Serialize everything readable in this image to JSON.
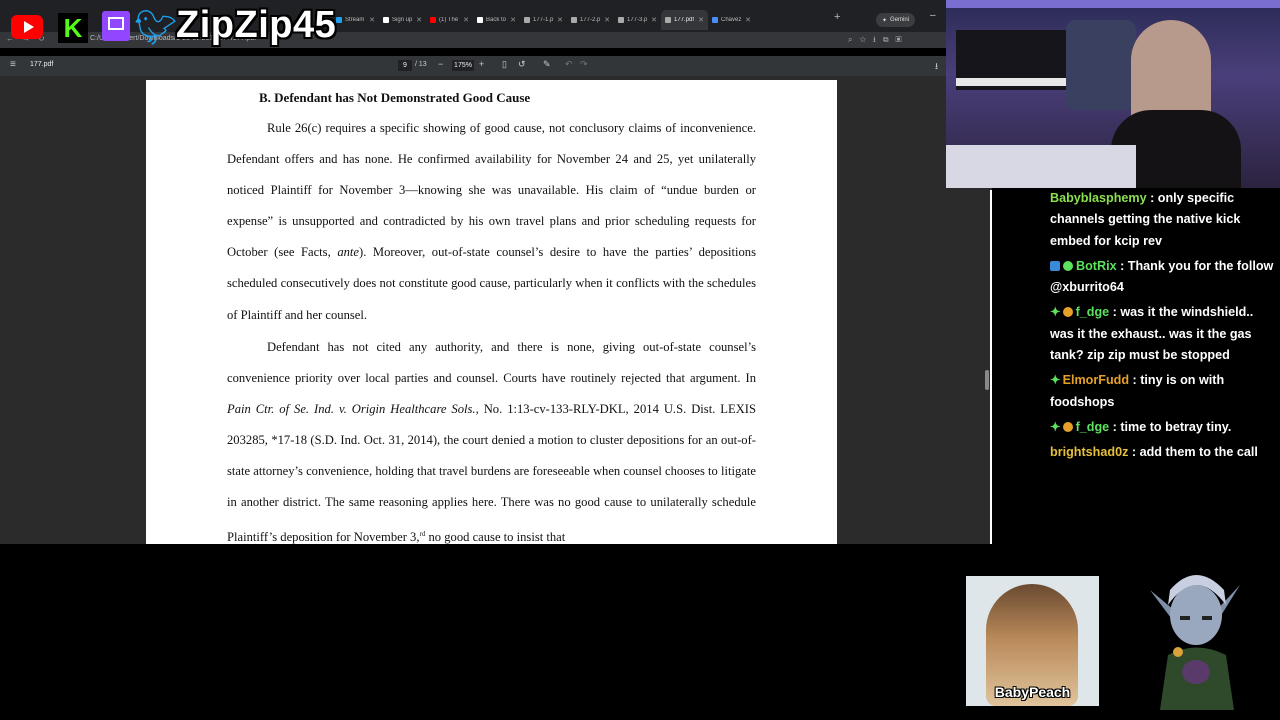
{
  "overlay": {
    "brand_name": "ZipZip45",
    "logos": [
      "youtube-logo",
      "kick-logo",
      "twitch-logo",
      "twitter-logo"
    ]
  },
  "browser": {
    "tabs": [
      {
        "title": "Stream",
        "color": "#1da1f2"
      },
      {
        "title": "Sign up",
        "color": "#ffffff"
      },
      {
        "title": "(1) The",
        "color": "#ff0000"
      },
      {
        "title": "Back to",
        "color": "#ffffff"
      },
      {
        "title": "177-1.p",
        "color": "#aaaaaa"
      },
      {
        "title": "177-2.p",
        "color": "#aaaaaa"
      },
      {
        "title": "177-3.p",
        "color": "#aaaaaa"
      },
      {
        "title": "177.pdf",
        "color": "#aaaaaa",
        "active": true
      },
      {
        "title": "Chavez",
        "color": "#4a8df8"
      }
    ],
    "gemini_label": "Gemini",
    "url": "C:/Users/robert/Downloads/1-25-cv-2019/177/177.pdf"
  },
  "pdf_toolbar": {
    "file_name": "177.pdf",
    "page_current": "9",
    "page_total": "/ 13",
    "zoom": "175%"
  },
  "document": {
    "heading": "B. Defendant has Not Demonstrated Good Cause",
    "para1": "Rule 26(c) requires a specific showing of good cause, not conclusory claims of inconvenience. Defendant offers and has none. He confirmed availability for November 24 and 25, yet unilaterally noticed Plaintiff for November 3—knowing she was unavailable. His claim of “undue burden or expense” is unsupported and contradicted by his own travel plans and prior scheduling requests for October (see Facts, ",
    "para1_italic": "ante",
    "para1_end": "). Moreover, out-of-state counsel’s desire to have the parties’ depositions scheduled consecutively does not constitute good cause, particularly when it conflicts with the schedules of Plaintiff and her counsel.",
    "para2_start": "Defendant has not cited any authority, and there is none, giving out-of-state counsel’s convenience priority over local parties and counsel. Courts have routinely rejected that argument. In ",
    "para2_case": "Pain Ctr. of Se. Ind. v. Origin Healthcare Sols.",
    "para2_mid": ", No. 1:13-cv-133-RLY-DKL, 2014 U.S. Dist. LEXIS 203285, *17-18 (S.D. Ind. Oct. 31, 2014), the court denied a motion to cluster depositions for an out-of-state attorney’s convenience, holding that travel burdens are foreseeable when counsel chooses to litigate in another district. The same reasoning applies here. There was no good cause to unilaterally schedule Plaintiff’s deposition for November 3,",
    "para2_sup": "rd",
    "para2_end": " no good cause to insist that"
  },
  "chat": [
    {
      "user": "Babyblasphemy",
      "color": "#8be04e",
      "text": " : only specific channels getting the native kick embed for kcip rev",
      "badges": []
    },
    {
      "user": "BotRix",
      "color": "#5ce25c",
      "text": " : Thank you for the follow @xburrito64",
      "badges": [
        "bot-badge",
        "verified-badge"
      ]
    },
    {
      "user": "f_dge",
      "color": "#5ce25c",
      "text": " : was it the windshield.. was it the exhaust.. was it the gas tank? zip zip must be stopped",
      "badges": [
        "gem-badge",
        "sub-badge"
      ]
    },
    {
      "user": "ElmorFudd",
      "color": "#e6a02a",
      "text": " : tiny is on with foodshops",
      "badges": [
        "gem-badge"
      ]
    },
    {
      "user": "f_dge",
      "color": "#5ce25c",
      "text": " : time to betray tiny.",
      "badges": [
        "gem-badge",
        "sub-badge"
      ]
    },
    {
      "user": "brightshad0z",
      "color": "#e6c03a",
      "text": " : add them to the call",
      "badges": []
    }
  ],
  "cards": {
    "peach_label": "BabyPeach"
  }
}
